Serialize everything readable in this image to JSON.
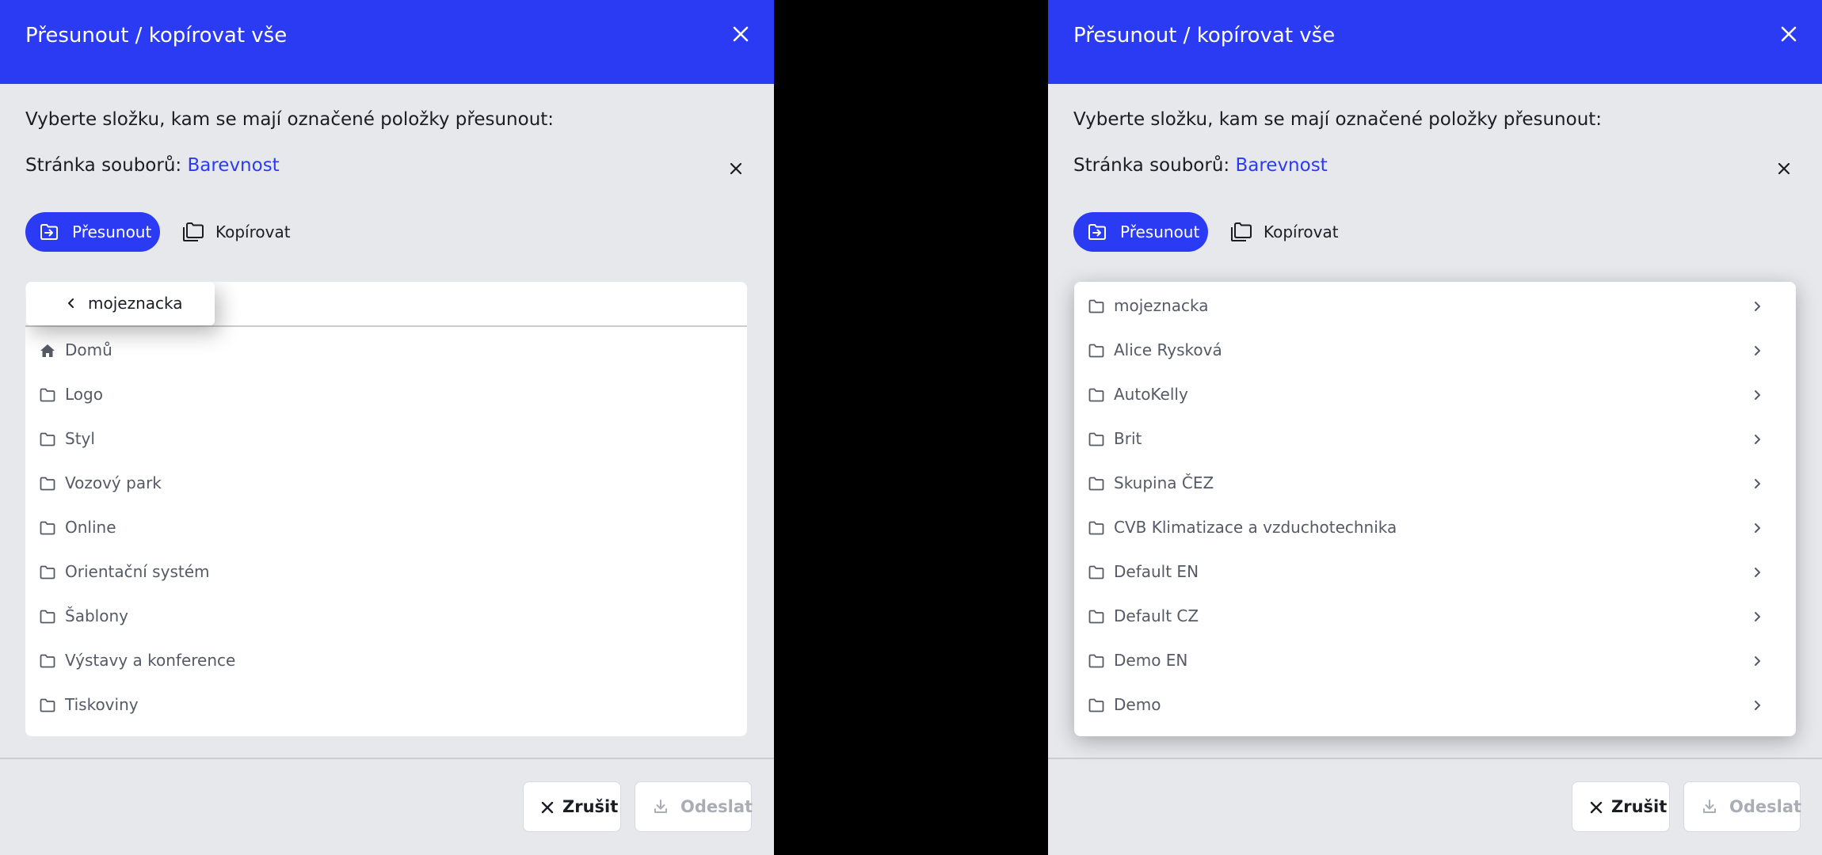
{
  "colors": {
    "accent": "#2b3bf4",
    "panel_bg": "#e6e8ec",
    "backdrop": "#000000"
  },
  "left_panel": {
    "title": "Přesunout / kopírovat vše",
    "prompt": "Vyberte složku, kam se mají označené položky přesunout:",
    "page_label": "Stránka souborů:",
    "page_link": "Barevnost",
    "move_label": "Přesunout",
    "copy_label": "Kopírovat",
    "breadcrumb": "mojeznacka",
    "items": [
      {
        "label": "Domů",
        "icon": "home-icon"
      },
      {
        "label": "Logo",
        "icon": "folder-icon"
      },
      {
        "label": "Styl",
        "icon": "folder-icon"
      },
      {
        "label": "Vozový park",
        "icon": "folder-icon"
      },
      {
        "label": "Online",
        "icon": "folder-icon"
      },
      {
        "label": "Orientační systém",
        "icon": "folder-icon"
      },
      {
        "label": "Šablony",
        "icon": "folder-icon"
      },
      {
        "label": "Výstavy a konference",
        "icon": "folder-icon"
      },
      {
        "label": "Tiskoviny",
        "icon": "folder-icon"
      }
    ],
    "cancel_label": "Zrušit",
    "submit_label": "Odeslat"
  },
  "right_panel": {
    "title": "Přesunout / kopírovat vše",
    "prompt": "Vyberte složku, kam se mají označené položky přesunout:",
    "page_label": "Stránka souborů:",
    "page_link": "Barevnost",
    "move_label": "Přesunout",
    "copy_label": "Kopírovat",
    "items": [
      {
        "label": "mojeznacka",
        "icon": "folder-icon"
      },
      {
        "label": "Alice Rysková",
        "icon": "folder-icon"
      },
      {
        "label": "AutoKelly",
        "icon": "folder-icon"
      },
      {
        "label": "Brit",
        "icon": "folder-icon"
      },
      {
        "label": "Skupina ČEZ",
        "icon": "folder-icon"
      },
      {
        "label": "CVB Klimatizace a vzduchotechnika",
        "icon": "folder-icon"
      },
      {
        "label": "Default EN",
        "icon": "folder-icon"
      },
      {
        "label": "Default CZ",
        "icon": "folder-icon"
      },
      {
        "label": "Demo EN",
        "icon": "folder-icon"
      },
      {
        "label": "Demo",
        "icon": "folder-icon"
      }
    ],
    "cancel_label": "Zrušit",
    "submit_label": "Odeslat"
  }
}
